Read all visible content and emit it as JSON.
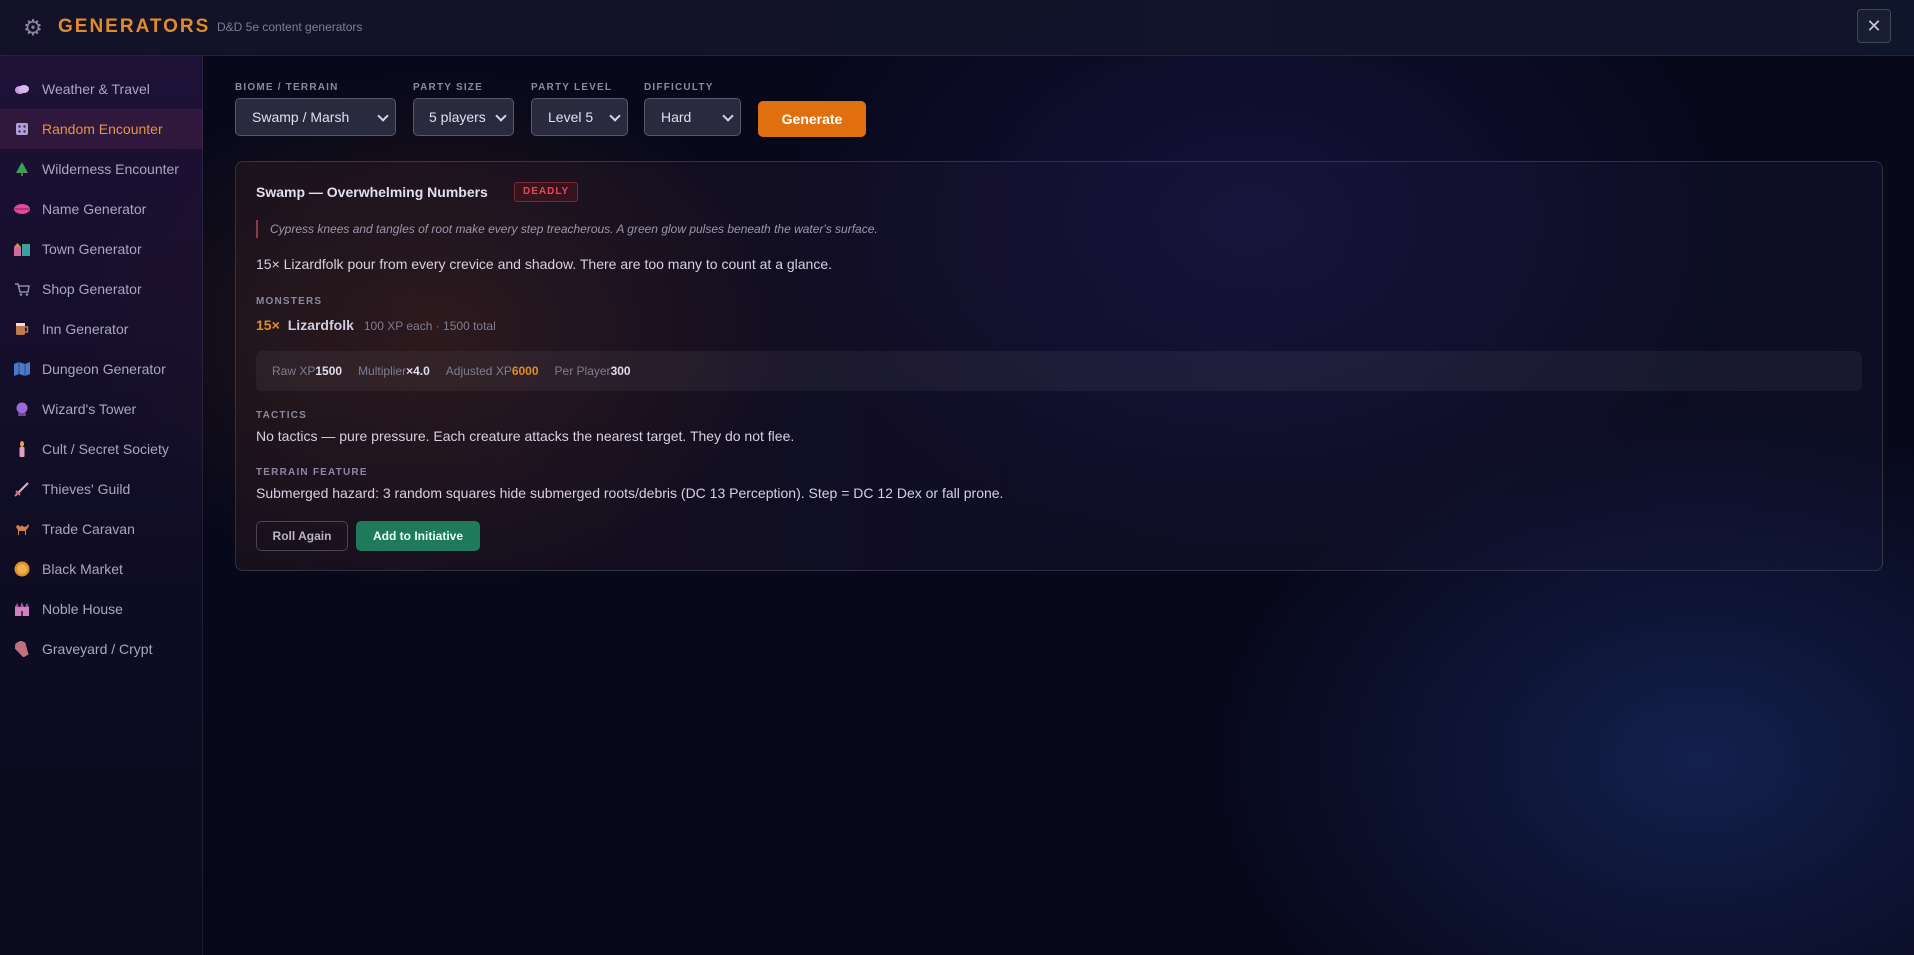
{
  "header": {
    "icon": "gear-icon",
    "title": "GENERATORS",
    "subtitle": "D&D 5e content generators",
    "close_label": "✕"
  },
  "sidebar": {
    "active": "Random Encounter",
    "items": [
      {
        "label": "Weather & Travel",
        "icon": "cloud-icon",
        "color": "#c8a0e0"
      },
      {
        "label": "Random Encounter",
        "icon": "dice-icon",
        "color": "#b0a0d8"
      },
      {
        "label": "Wilderness Encounter",
        "icon": "tree-icon",
        "color": "#3aa05a"
      },
      {
        "label": "Name Generator",
        "icon": "lips-icon",
        "color": "#e04a9a"
      },
      {
        "label": "Town Generator",
        "icon": "town-icon",
        "color": "#d06aa0"
      },
      {
        "label": "Shop Generator",
        "icon": "cart-icon",
        "color": "#8a8aa8"
      },
      {
        "label": "Inn Generator",
        "icon": "mug-icon",
        "color": "#c07850"
      },
      {
        "label": "Dungeon Generator",
        "icon": "map-icon",
        "color": "#4a7ac8"
      },
      {
        "label": "Wizard's Tower",
        "icon": "crystal-ball-icon",
        "color": "#9a6ad8"
      },
      {
        "label": "Cult / Secret Society",
        "icon": "candle-icon",
        "color": "#e0a0c0"
      },
      {
        "label": "Thieves' Guild",
        "icon": "dagger-icon",
        "color": "#d07090"
      },
      {
        "label": "Trade Caravan",
        "icon": "camel-icon",
        "color": "#d0804a"
      },
      {
        "label": "Black Market",
        "icon": "coin-icon",
        "color": "#e0902a"
      },
      {
        "label": "Noble House",
        "icon": "castle-icon",
        "color": "#d080c0"
      },
      {
        "label": "Graveyard / Crypt",
        "icon": "coffin-icon",
        "color": "#c07080"
      }
    ]
  },
  "controls": {
    "biome": {
      "label": "BIOME / TERRAIN",
      "value": "Swamp / Marsh"
    },
    "party_size": {
      "label": "PARTY SIZE",
      "value": "5 players"
    },
    "party_level": {
      "label": "PARTY LEVEL",
      "value": "Level 5"
    },
    "difficulty": {
      "label": "DIFFICULTY",
      "value": "Hard"
    },
    "generate_label": "Generate"
  },
  "encounter": {
    "title": "Swamp — Overwhelming Numbers",
    "badge": "DEADLY",
    "flavor": "Cypress knees and tangles of root make every step treacherous. A green glow pulses beneath the water's surface.",
    "summary": "15× Lizardfolk pour from every crevice and shadow. There are too many to count at a glance.",
    "monsters_label": "MONSTERS",
    "monster": {
      "count": "15×",
      "name": "Lizardfolk",
      "xp": "100 XP each · 1500 total"
    },
    "xp": {
      "raw_label": "Raw XP",
      "raw_value": "1500",
      "mult_label": "Multiplier",
      "mult_value": "×4.0",
      "adj_label": "Adjusted XP",
      "adj_value": "6000",
      "per_label": "Per Player",
      "per_value": "300"
    },
    "tactics_label": "TACTICS",
    "tactics": "No tactics — pure pressure. Each creature attacks the nearest target. They do not flee.",
    "terrain_label": "TERRAIN FEATURE",
    "terrain": "Submerged hazard: 3 random squares hide submerged roots/debris (DC 13 Perception). Step = DC 12 Dex or fall prone.",
    "roll_again_label": "Roll Again",
    "add_init_label": "Add to Initiative"
  }
}
